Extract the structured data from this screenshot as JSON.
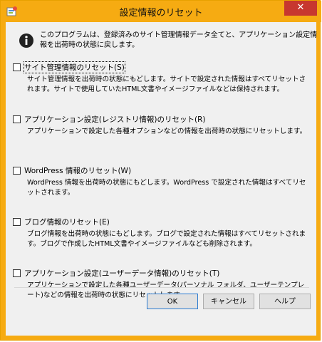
{
  "window": {
    "title": "設定情報のリセット",
    "close_glyph": "✕",
    "accent_color": "#f6ab12"
  },
  "info": {
    "icon": "info-icon",
    "text": "このプログラムは、登録済みのサイト管理情報データ全てと、アプリケーション設定情報を出荷時の状態に戻します。"
  },
  "options": [
    {
      "label": "サイト管理情報のリセット(S)",
      "checked": false,
      "description": "サイト管理情報を出荷時の状態にもどします。サイトで設定された情報はすべてリセットされます。サイトで使用していたHTML文書やイメージファイルなどは保持されます。"
    },
    {
      "label": "アプリケーション設定(レジストリ情報)のリセット(R)",
      "checked": false,
      "description": "アプリケーションで設定した各種オプションなどの情報を出荷時の状態にリセットします。"
    },
    {
      "label": "WordPress 情報のリセット(W)",
      "checked": false,
      "description": "WordPress 情報を出荷時の状態にもどします。WordPress で設定された情報はすべてリセットされます。"
    },
    {
      "label": "ブログ情報のリセット(E)",
      "checked": false,
      "description": "ブログ情報を出荷時の状態にもどします。ブログで設定された情報はすべてリセットされます。ブログで作成したHTML文書やイメージファイルなども削除されます。"
    },
    {
      "label": "アプリケーション設定(ユーザーデータ情報)のリセット(T)",
      "checked": false,
      "description": "アプリケーションで設定した各種ユーザーデータ(パーソナル フォルダ、ユーザーテンプレート)などの情報を出荷時の状態にリセットします。"
    }
  ],
  "buttons": {
    "ok": "OK",
    "cancel": "キャンセル",
    "help": "ヘルプ"
  }
}
